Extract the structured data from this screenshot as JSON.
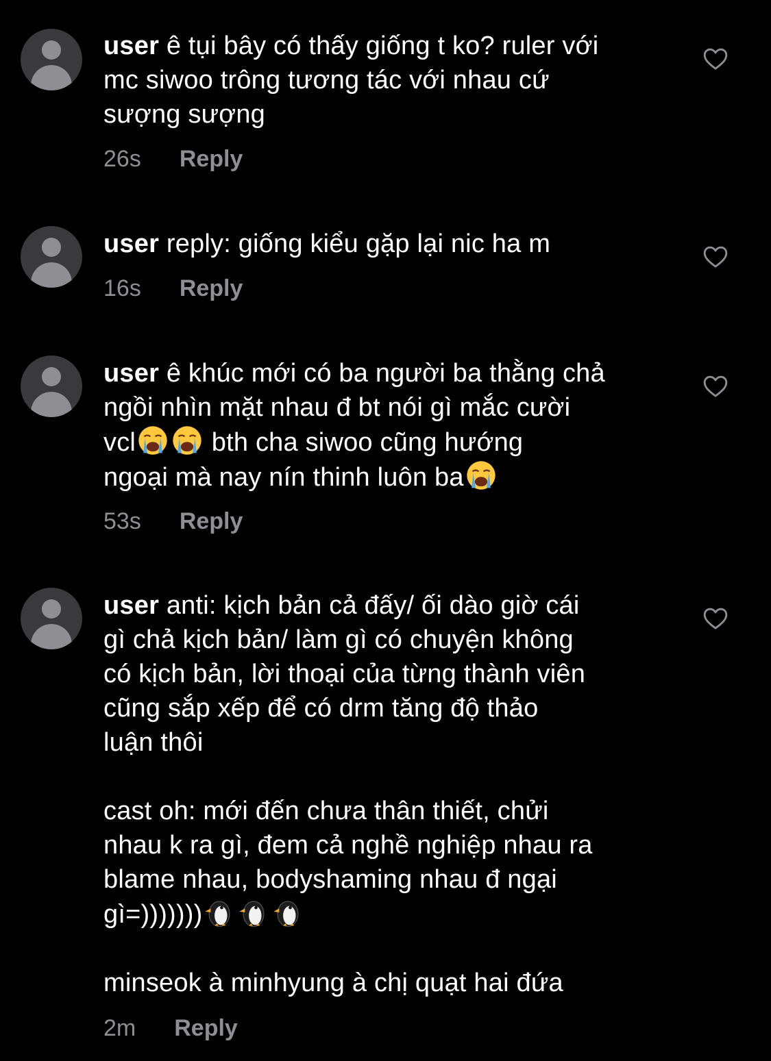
{
  "comments": [
    {
      "username": "user",
      "text": " ê tụi bây có thấy giống t ko? ruler với\nmc siwoo trông tương tác với nhau cứ\nsượng sượng",
      "time": "26s",
      "reply_label": "Reply"
    },
    {
      "username": "user",
      "text": " reply: giống kiểu gặp lại nic ha m",
      "time": "16s",
      "reply_label": "Reply"
    },
    {
      "username": "user",
      "text_a": " ê khúc mới có ba người ba thằng chả\nngồi nhìn mặt nhau đ bt nói gì mắc cười\nvcl",
      "text_b": " bth cha siwoo cũng hướng\nngoại mà nay nín thinh luôn ba",
      "emoji": "loudly-crying-face",
      "time": "53s",
      "reply_label": "Reply"
    },
    {
      "username": "user",
      "text_a": " anti: kịch bản cả đấy/ ối dào giờ cái\ngì chả kịch bản/ làm gì có chuyện không\ncó kịch bản, lời thoại của từng thành viên\ncũng sắp xếp để có drm tăng độ thảo\nluận thôi\n\ncast oh: mới đến chưa thân thiết, chửi\nnhau k ra gì, đem cả nghề nghiệp nhau ra\nblame nhau, bodyshaming nhau đ ngại\ngì=)))))))",
      "text_b": "\n\nminseok à minhyung à chị quạt hai đứa",
      "emoji": "penguin",
      "time": "2m",
      "reply_label": "Reply"
    }
  ]
}
